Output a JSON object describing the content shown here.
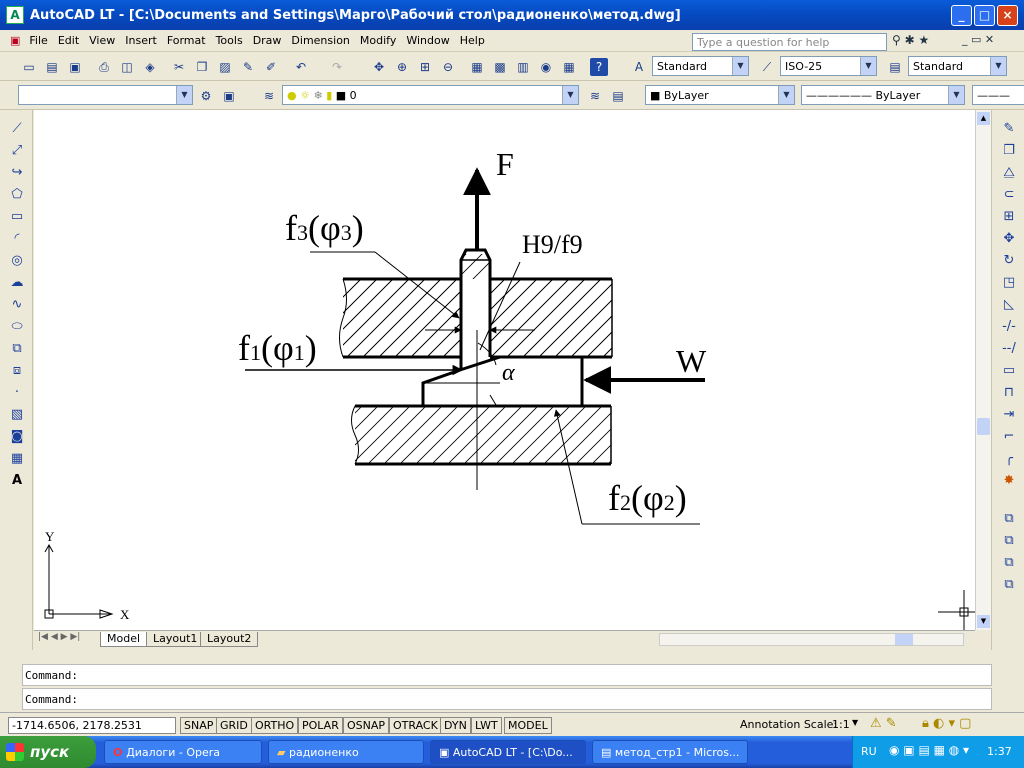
{
  "window": {
    "title": "AutoCAD LT - [C:\\Documents and Settings\\Марго\\Рабочий стол\\радионенко\\метод.dwg]",
    "min": "_",
    "max": "□",
    "close": "×"
  },
  "menu": [
    "File",
    "Edit",
    "View",
    "Insert",
    "Format",
    "Tools",
    "Draw",
    "Dimension",
    "Modify",
    "Window",
    "Help"
  ],
  "help_placeholder": "Type a question for help",
  "styles": {
    "text_style": "Standard",
    "dim_style": "ISO-25",
    "table_style": "Standard"
  },
  "layers": {
    "workspace": "",
    "current_layer": "0",
    "color": "ByLayer",
    "linetype": "ByLayer"
  },
  "drawing": {
    "label_F": "F",
    "label_W": "W",
    "label_fit": "H9/f9",
    "label_alpha": "α",
    "f3_main": "f",
    "f3_sub": "3",
    "f3_phi": "φ",
    "f3_phisub": "3",
    "f1_main": "f",
    "f1_sub": "1",
    "f1_phi": "φ",
    "f1_phisub": "1",
    "f2_main": "f",
    "f2_sub": "2",
    "f2_phi": "φ",
    "f2_phisub": "2",
    "ucs_x": "X",
    "ucs_y": "Y"
  },
  "tabs": [
    "Model",
    "Layout1",
    "Layout2"
  ],
  "command": {
    "line1": "Command:",
    "line2": "Command:"
  },
  "status": {
    "coords": "-1714.6506, 2178.2531",
    "toggles": [
      "SNAP",
      "GRID",
      "ORTHO",
      "POLAR",
      "OSNAP",
      "OTRACK",
      "DYN",
      "LWT",
      "MODEL"
    ],
    "annotation_scale_label": "Annotation Scale:",
    "annotation_scale_value": "1:1"
  },
  "taskbar": {
    "start": "пуск",
    "tasks": [
      "Диалоги - Opera",
      "радионенко",
      "AutoCAD LT - [C:\\Do...",
      "метод_стр1 - Micros..."
    ],
    "lang": "RU",
    "time": "1:37"
  }
}
